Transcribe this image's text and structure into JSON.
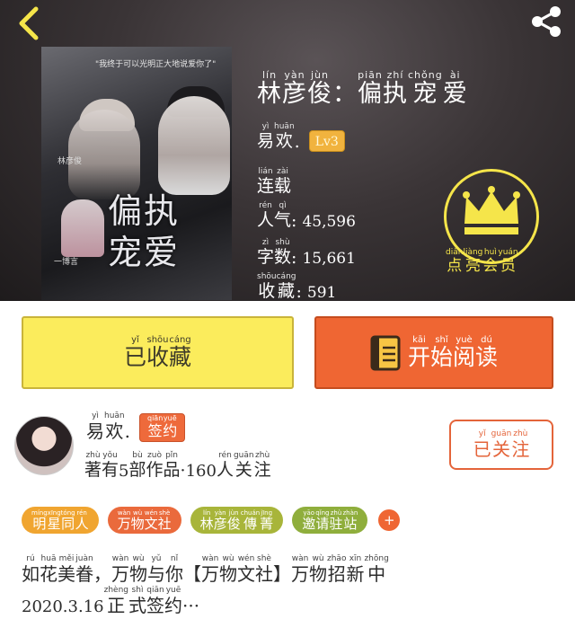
{
  "header": {
    "book": {
      "title": [
        {
          "hz": "林",
          "py": "lín"
        },
        {
          "hz": "彦",
          "py": "yàn"
        },
        {
          "hz": "俊",
          "py": "jùn"
        },
        {
          "hz": "：",
          "py": ""
        },
        {
          "hz": "偏",
          "py": "piān"
        },
        {
          "hz": "执",
          "py": "zhí"
        },
        {
          "hz": "宠",
          "py": "chǒng"
        },
        {
          "hz": "爱",
          "py": "ài"
        }
      ],
      "cover": {
        "tagline": "\"我终于可以光明正大地说爱你了\"",
        "artist_a": "王俊凯",
        "artist_b": "林彦俊",
        "small_credit": "一博言",
        "title_line1": "偏执",
        "title_line2": "宠爱"
      }
    },
    "author": {
      "hz": [
        "易",
        "欢"
      ],
      "py": [
        "yì",
        "huān"
      ],
      "suffix": ".",
      "level": "Lv3"
    },
    "status": {
      "hz": [
        "连",
        "载"
      ],
      "py": [
        "lián",
        "zài"
      ]
    },
    "popularity": {
      "hz": [
        "人",
        "气"
      ],
      "py": [
        "rén",
        "qì"
      ],
      "colon": ":",
      "value": "45,596"
    },
    "word_count": {
      "hz": [
        "字",
        "数"
      ],
      "py": [
        "zì",
        "shù"
      ],
      "colon": ":",
      "value": "15,661"
    },
    "favorites": {
      "hz": [
        "收",
        "藏"
      ],
      "py": [
        "shōu",
        "cáng"
      ],
      "colon": ":",
      "value": "591"
    },
    "vip": {
      "hz": [
        "点",
        "亮",
        "会",
        "员"
      ],
      "py": [
        "diǎn",
        "liàng",
        "huì",
        "yuán"
      ],
      "icon": "crown-icon",
      "color": "#f5e54a"
    },
    "back_icon": "chevron-left-icon",
    "share_icon": "share-icon"
  },
  "actions": {
    "collect": {
      "hz": [
        "已",
        "收",
        "藏"
      ],
      "py": [
        "yǐ",
        "shōu",
        "cáng"
      ],
      "color": "#fbec5c"
    },
    "read": {
      "hz": [
        "开",
        "始",
        "阅",
        "读"
      ],
      "py": [
        "kāi",
        "shǐ",
        "yuè",
        "dú"
      ],
      "color": "#ef6633",
      "icon": "book-icon"
    }
  },
  "author_card": {
    "name": {
      "hz": [
        "易",
        "欢"
      ],
      "py": [
        "yì",
        "huān"
      ],
      "suffix": "."
    },
    "signed_badge": {
      "hz": [
        "签",
        "约"
      ],
      "py": [
        "qiān",
        "yuē"
      ]
    },
    "stats": {
      "pre": {
        "hz": [
          "著",
          "有"
        ],
        "py": [
          "zhù",
          "yǒu"
        ]
      },
      "works_count": "5",
      "mid": {
        "hz": [
          "部",
          "作",
          "品"
        ],
        "py": [
          "bù",
          "zuò",
          "pǐn"
        ]
      },
      "sep": "·",
      "followers_count": "160",
      "post": {
        "hz": [
          "人",
          "关",
          "注"
        ],
        "py": [
          "rén",
          "guān",
          "zhù"
        ]
      }
    },
    "follow_button": {
      "hz": [
        "已",
        "关",
        "注"
      ],
      "py": [
        "yǐ",
        "guān",
        "zhù"
      ]
    }
  },
  "tags": [
    {
      "hz": [
        "明",
        "星",
        "同",
        "人"
      ],
      "py": [
        "míng",
        "xīng",
        "tóng",
        "rén"
      ],
      "color": "#f0a530"
    },
    {
      "hz": [
        "万",
        "物",
        "文",
        "社"
      ],
      "py": [
        "wàn",
        "wù",
        "wén",
        "shè"
      ],
      "color": "#ea6a3c"
    },
    {
      "hz": [
        "林",
        "彦",
        "俊",
        "傳",
        "菁"
      ],
      "py": [
        "lín",
        "yàn",
        "jùn",
        "chuán",
        "jīng"
      ],
      "color": "#a8b53a"
    },
    {
      "hz": [
        "邀",
        "请",
        "驻",
        "站"
      ],
      "py": [
        "yāo",
        "qǐng",
        "zhù",
        "zhàn"
      ],
      "color": "#8fae3c"
    }
  ],
  "tags_add_label": "+",
  "intro": {
    "line1": [
      {
        "hz": "如",
        "py": "rú"
      },
      {
        "hz": "花",
        "py": "huā"
      },
      {
        "hz": "美",
        "py": "měi"
      },
      {
        "hz": "眷",
        "py": "juàn"
      },
      {
        "hz": "，",
        "py": ""
      },
      {
        "hz": "万",
        "py": "wàn"
      },
      {
        "hz": "物",
        "py": "wù"
      },
      {
        "hz": "与",
        "py": "yǔ"
      },
      {
        "hz": "你",
        "py": "nǐ"
      },
      {
        "hz": "【",
        "py": ""
      },
      {
        "hz": "万",
        "py": "wàn"
      },
      {
        "hz": "物",
        "py": "wù"
      },
      {
        "hz": "文",
        "py": "wén"
      },
      {
        "hz": "社",
        "py": "shè"
      },
      {
        "hz": "】",
        "py": ""
      },
      {
        "hz": "万",
        "py": "wàn"
      },
      {
        "hz": "物",
        "py": "wù"
      },
      {
        "hz": "招",
        "py": "zhāo"
      },
      {
        "hz": "新",
        "py": "xīn"
      },
      {
        "hz": "中",
        "py": "zhōng"
      }
    ],
    "line2_date": "2020.3.16",
    "line2_rest": [
      {
        "hz": "正",
        "py": "zhèng"
      },
      {
        "hz": "式",
        "py": "shì"
      },
      {
        "hz": "签",
        "py": "qiān"
      },
      {
        "hz": "约",
        "py": "yuē"
      }
    ],
    "line2_ellipsis": "···"
  }
}
